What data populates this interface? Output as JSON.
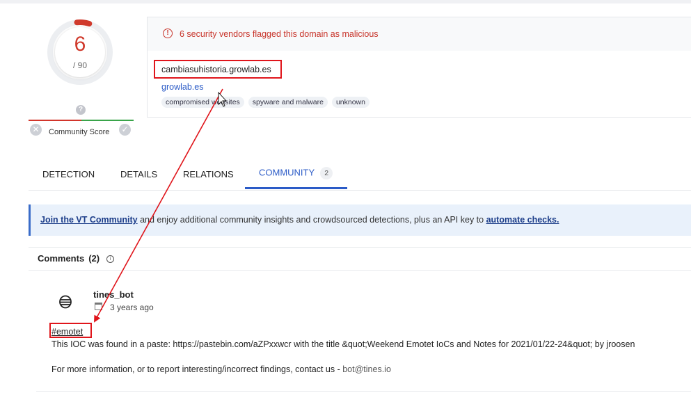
{
  "score": {
    "detections": "6",
    "total": "/ 90",
    "detections_value": 6,
    "total_value": 90
  },
  "community_score": {
    "label": "Community Score",
    "unknown_glyph": "?"
  },
  "alert": {
    "text": "6 security vendors flagged this domain as malicious",
    "icon": "alert-circle-icon"
  },
  "domain": {
    "name": "cambiasuhistoria.growlab.es",
    "parent": "growlab.es"
  },
  "tags": [
    "compromised websites",
    "spyware and malware",
    "unknown"
  ],
  "tabs": [
    {
      "label": "DETECTION"
    },
    {
      "label": "DETAILS"
    },
    {
      "label": "RELATIONS"
    },
    {
      "label": "COMMUNITY",
      "badge": "2",
      "active": true
    }
  ],
  "banner": {
    "link1": "Join the VT Community",
    "middle": " and enjoy additional community insights and crowdsourced detections, plus an API key to ",
    "link2": "automate checks."
  },
  "comments": {
    "heading": "Comments",
    "count": "(2)",
    "items": [
      {
        "author": "tines_bot",
        "time": "3 years ago",
        "hashtag": "#emotet",
        "line1": "This IOC was found in a paste: https://pastebin.com/aZPxxwcr with the title &quot;Weekend Emotet IoCs and Notes for 2021/01/22-24&quot; by jroosen",
        "line2_prefix": "For more information, or to report interesting/incorrect findings, contact us - ",
        "line2_mail": "bot@tines.io"
      }
    ]
  },
  "colors": {
    "accent": "#2b5bc7",
    "danger": "#d03a2c",
    "annotation": "#e0151b",
    "positive": "#39a44a"
  }
}
